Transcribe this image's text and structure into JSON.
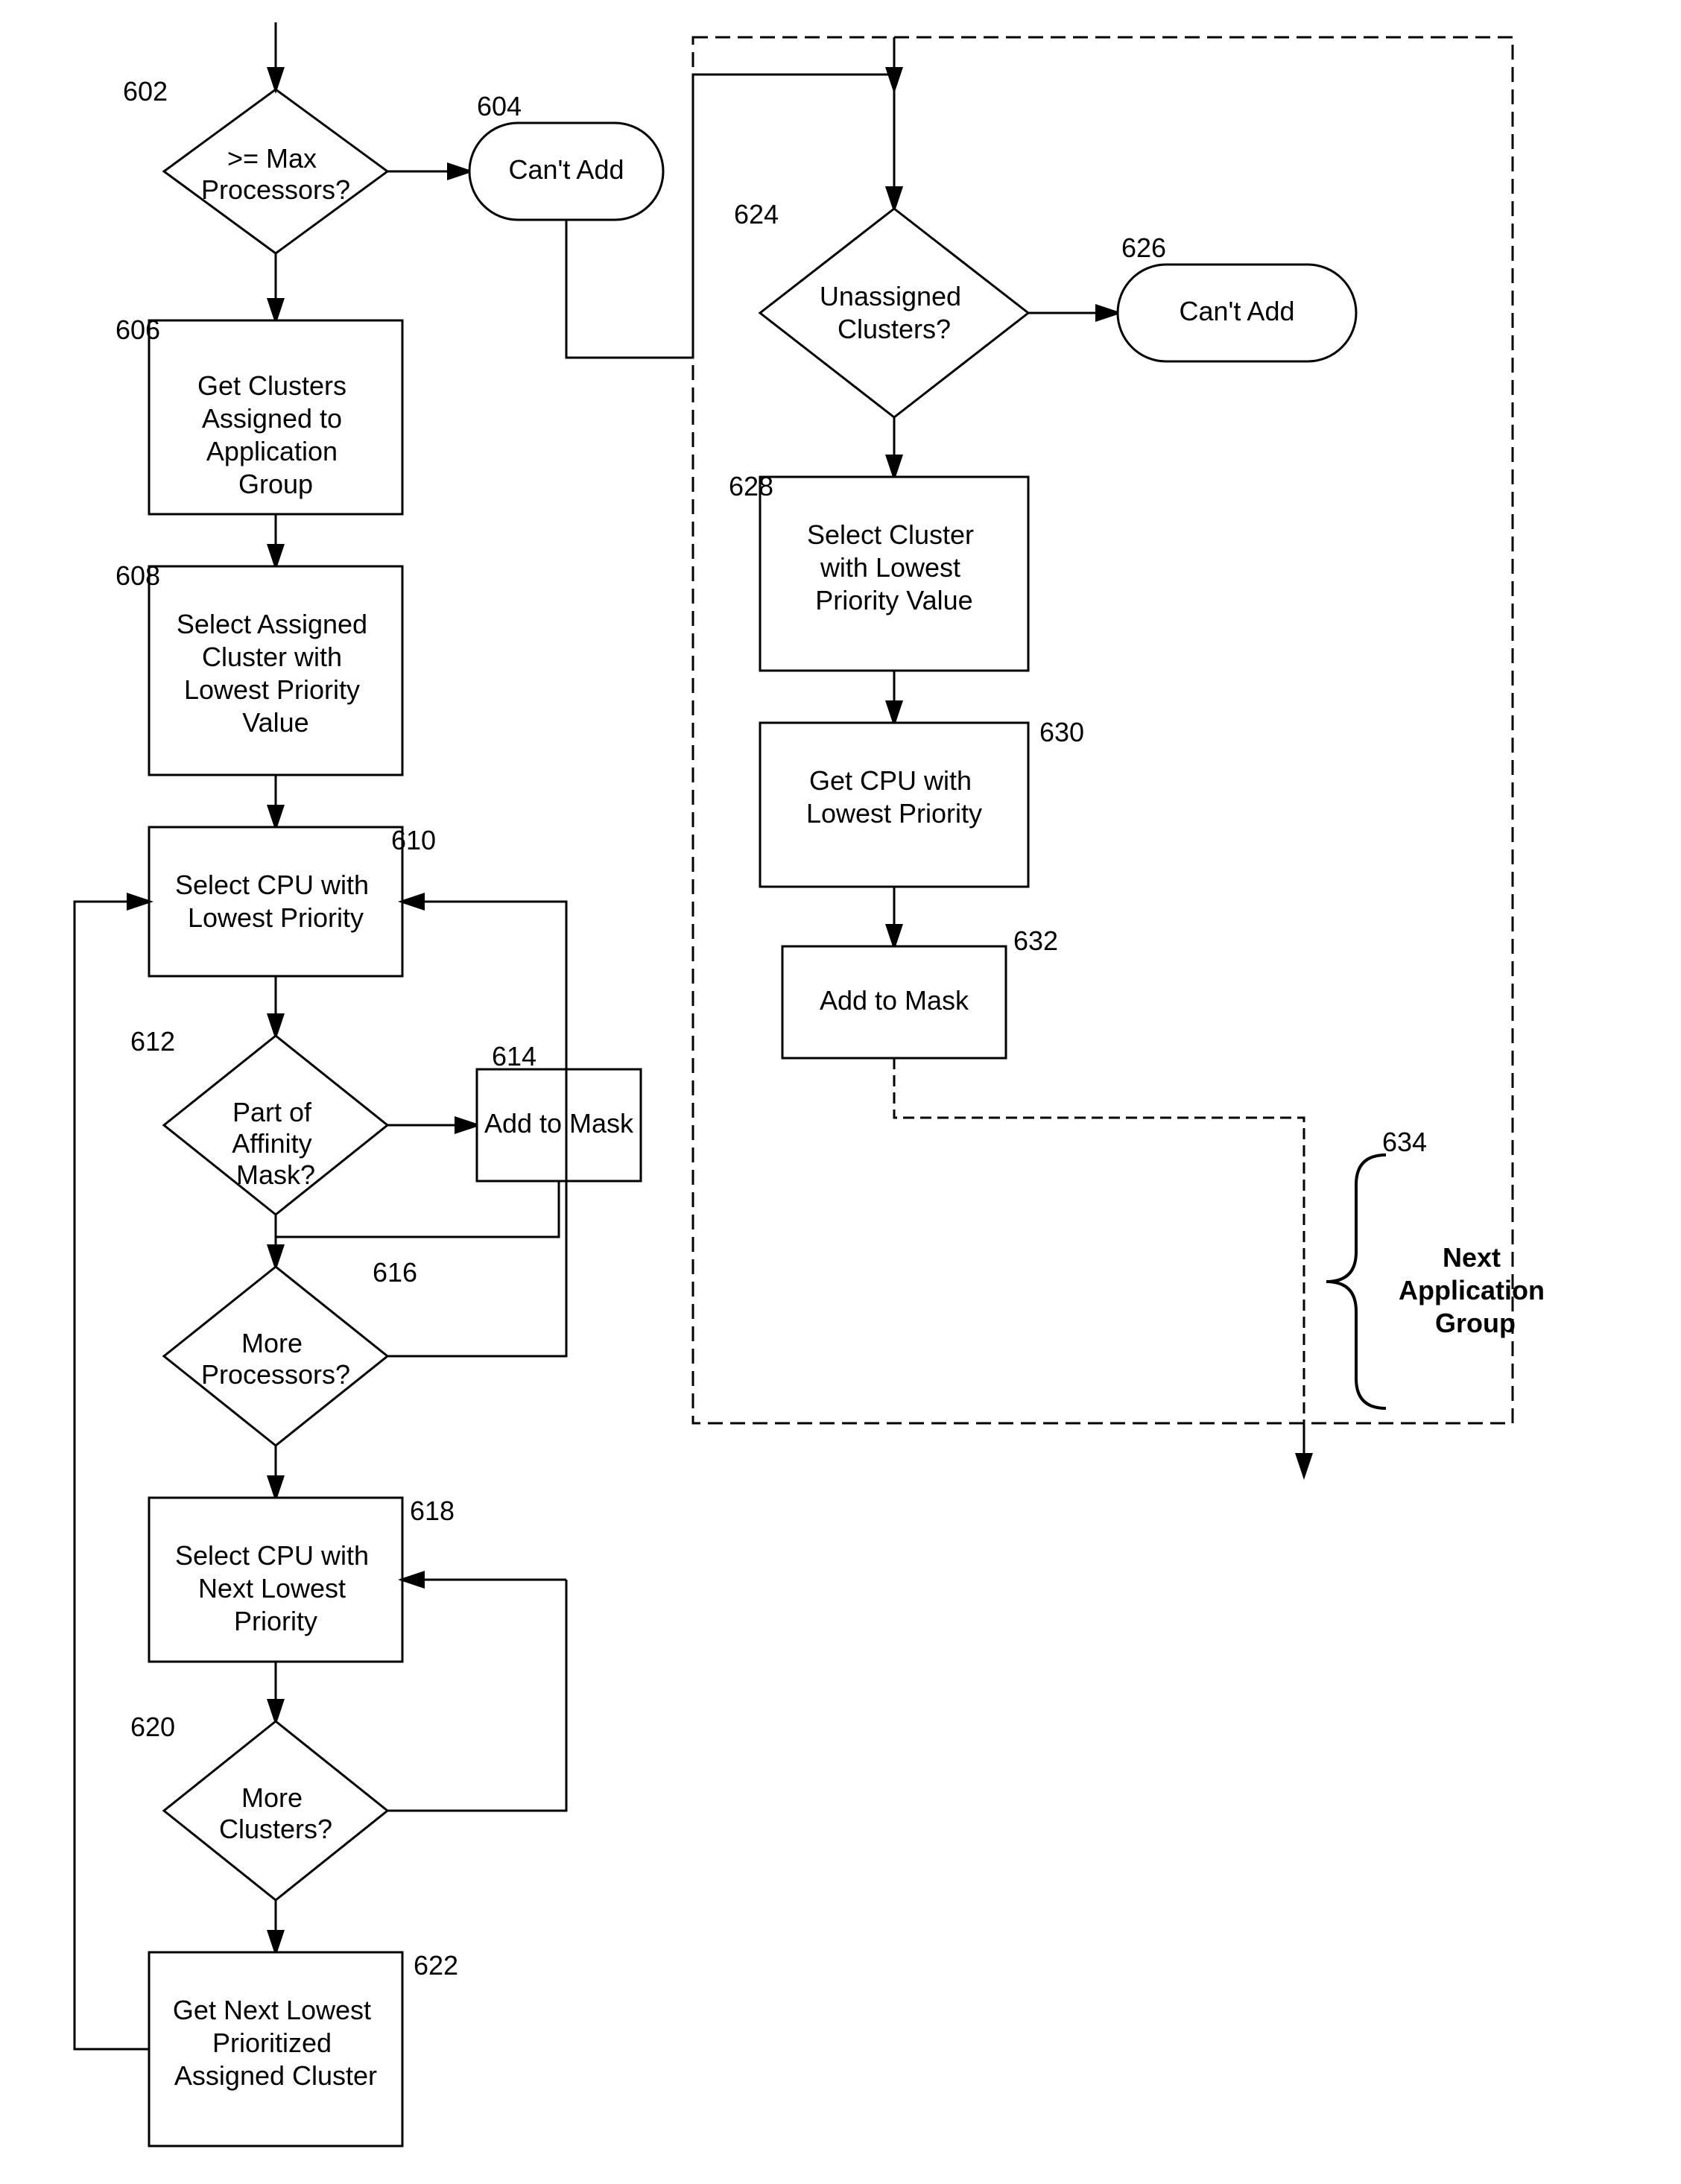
{
  "nodes": {
    "diamond602": {
      "label": ">= Max\nProcessors?",
      "ref": "602"
    },
    "cantAdd604": {
      "label": "Can't Add",
      "ref": "604"
    },
    "rect606": {
      "label": "Get Clusters\nAssigned to\nApplication\nGroup",
      "ref": "606"
    },
    "rect608": {
      "label": "Select Assigned\nCluster with\nLowest Priority\nValue",
      "ref": "608"
    },
    "rect610": {
      "label": "Select CPU with\nLowest Priority",
      "ref": "610"
    },
    "diamond612": {
      "label": "Part of\nAffinity\nMask?",
      "ref": "612"
    },
    "rect614": {
      "label": "Add to Mask",
      "ref": "614"
    },
    "diamond616": {
      "label": "More\nProcessors?",
      "ref": "616"
    },
    "rect618": {
      "label": "Select CPU with\nNext Lowest\nPriority",
      "ref": "618"
    },
    "diamond620": {
      "label": "More\nClusters?",
      "ref": "620"
    },
    "rect622": {
      "label": "Get Next Lowest\nPrioritized\nAssigned Cluster",
      "ref": "622"
    },
    "diamond624": {
      "label": "Unassigned\nClusters?",
      "ref": "624"
    },
    "cantAdd626": {
      "label": "Can't Add",
      "ref": "626"
    },
    "rect628": {
      "label": "Select Cluster\nwith Lowest\nPriority Value",
      "ref": "628"
    },
    "rect630": {
      "label": "Get CPU with\nLowest Priority",
      "ref": "630"
    },
    "rect632": {
      "label": "Add to Mask",
      "ref": "632"
    },
    "curly634": {
      "label": "Next\nApplication\nGroup",
      "ref": "634"
    }
  }
}
